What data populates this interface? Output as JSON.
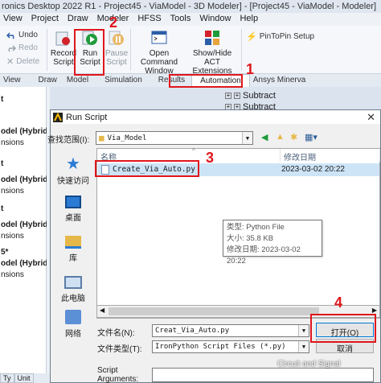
{
  "app": {
    "title": "ronics Desktop 2022 R1 - Project45 - ViaModel - 3D Modeler] - [Project45 - ViaModel - Modeler]",
    "menu": [
      "View",
      "Project",
      "Draw",
      "Modeler",
      "HFSS",
      "Tools",
      "Window",
      "Help"
    ]
  },
  "ribbon": {
    "undo": "Undo",
    "redo": "Redo",
    "delete": "Delete",
    "record_script": "Record Script",
    "run_script": "Run Script",
    "run_script_caret": "▾",
    "pause_script": "Pause Script",
    "open_command_window": "Open Command Window",
    "show_hide_act": "Show/Hide ACT Extensions",
    "pintopin": "PinToPin Setup",
    "tabs": [
      "View",
      "Draw",
      "Model",
      "Simulation",
      "Results",
      "Automation",
      "Ansys Minerva"
    ]
  },
  "side_tree": [
    "t",
    "odel (Hybrid T",
    "nsions",
    "t",
    "odel (Hybrid T",
    "nsions",
    "t",
    "odel (Hybrid T",
    "nsions",
    "5*",
    "odel (Hybrid",
    "nsions"
  ],
  "bg_tree": [
    "Subtract",
    "Subtract"
  ],
  "dialog": {
    "title": "Run Script",
    "look_in_label": "查找范围(I):",
    "look_in_value": "Via_Model",
    "col_name": "名称",
    "col_modified": "修改日期",
    "places": [
      "快速访问",
      "桌面",
      "库",
      "此电脑",
      "网络"
    ],
    "file": {
      "name": "Create_Via_Auto.py",
      "modified": "2023-03-02 20:22"
    },
    "tooltip": {
      "type": "类型: Python File",
      "size": "大小: 35.8 KB",
      "modified": "修改日期: 2023-03-02 20:22"
    },
    "filename_label": "文件名(N):",
    "filename_value": "Creat_Via_Auto.py",
    "filetype_label": "文件类型(T):",
    "filetype_value": "IronPython Script Files (*.py)",
    "open_button": "打开(O)",
    "cancel_button": "取消",
    "script_args_label": "Script Arguments:"
  },
  "annotations": [
    "1",
    "2",
    "3",
    "4"
  ],
  "bottom_tabs": [
    "Ty",
    "Unit"
  ],
  "watermark": "Circuit and Signal",
  "colors": {
    "annotation": "#e0161c",
    "selection": "#cde4f7",
    "accent": "#0078d7"
  }
}
